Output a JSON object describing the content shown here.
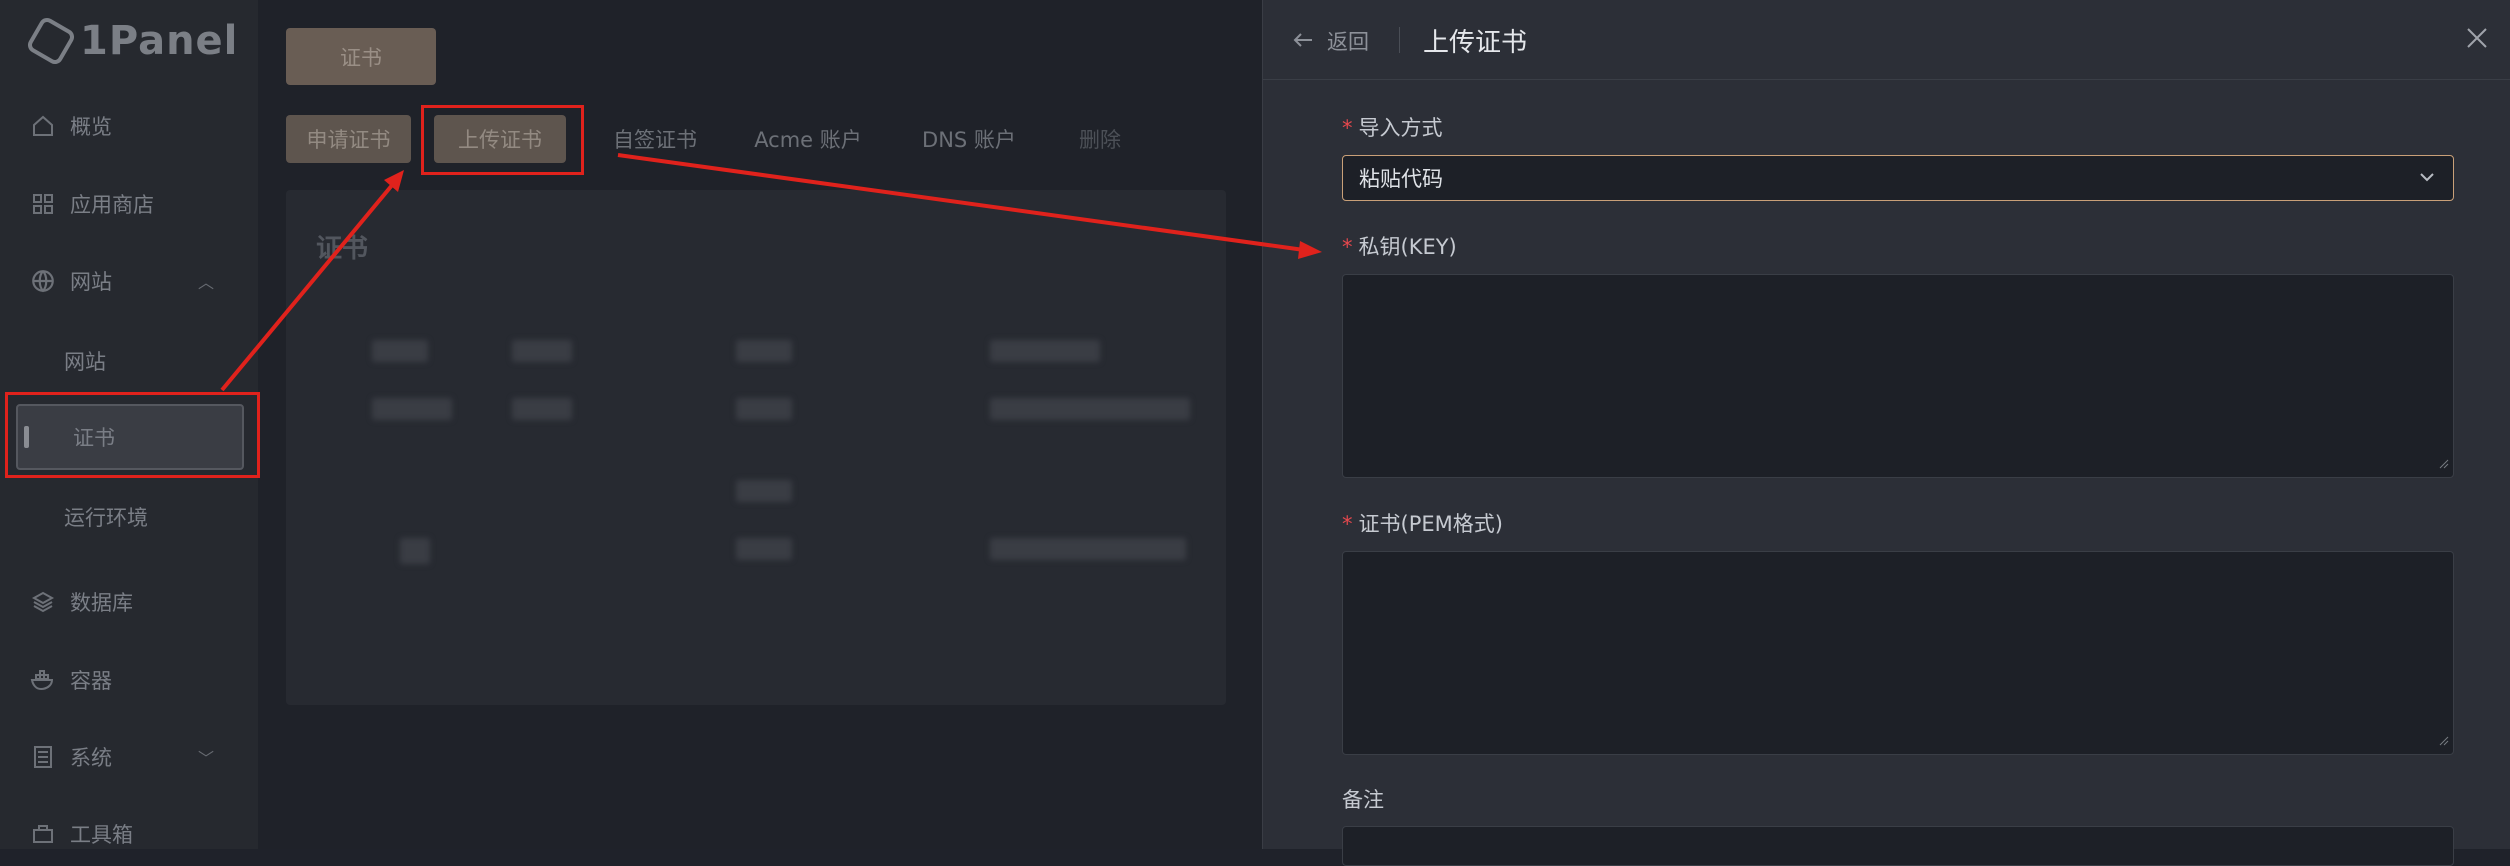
{
  "app": {
    "logo_text": "1Panel"
  },
  "sidebar": {
    "items": [
      {
        "label": "概览",
        "icon": "home-icon"
      },
      {
        "label": "应用商店",
        "icon": "grid-icon"
      },
      {
        "label": "网站",
        "icon": "globe-icon"
      },
      {
        "label": "数据库",
        "icon": "layers-icon"
      },
      {
        "label": "容器",
        "icon": "docker-icon"
      },
      {
        "label": "系统",
        "icon": "server-icon"
      },
      {
        "label": "工具箱",
        "icon": "toolbox-icon"
      }
    ],
    "sub_items": [
      {
        "label": "网站"
      },
      {
        "label": "证书"
      },
      {
        "label": "运行环境"
      }
    ]
  },
  "main": {
    "top_button": "证书",
    "tabs": [
      {
        "label": "申请证书"
      },
      {
        "label": "上传证书"
      },
      {
        "label": "自签证书"
      },
      {
        "label": "Acme 账户"
      },
      {
        "label": "DNS 账户"
      },
      {
        "label": "删除"
      }
    ],
    "card_title": "证书"
  },
  "drawer": {
    "back_label": "返回",
    "title": "上传证书",
    "fields": {
      "import_mode": {
        "label": "导入方式",
        "value": "粘贴代码"
      },
      "private_key": {
        "label": "私钥(KEY)",
        "value": ""
      },
      "certificate": {
        "label": "证书(PEM格式)",
        "value": ""
      },
      "remark": {
        "label": "备注",
        "value": ""
      }
    }
  },
  "colors": {
    "annotation_red": "#e0221c",
    "accent_border": "#c9a078",
    "required_star": "#e5484d"
  }
}
